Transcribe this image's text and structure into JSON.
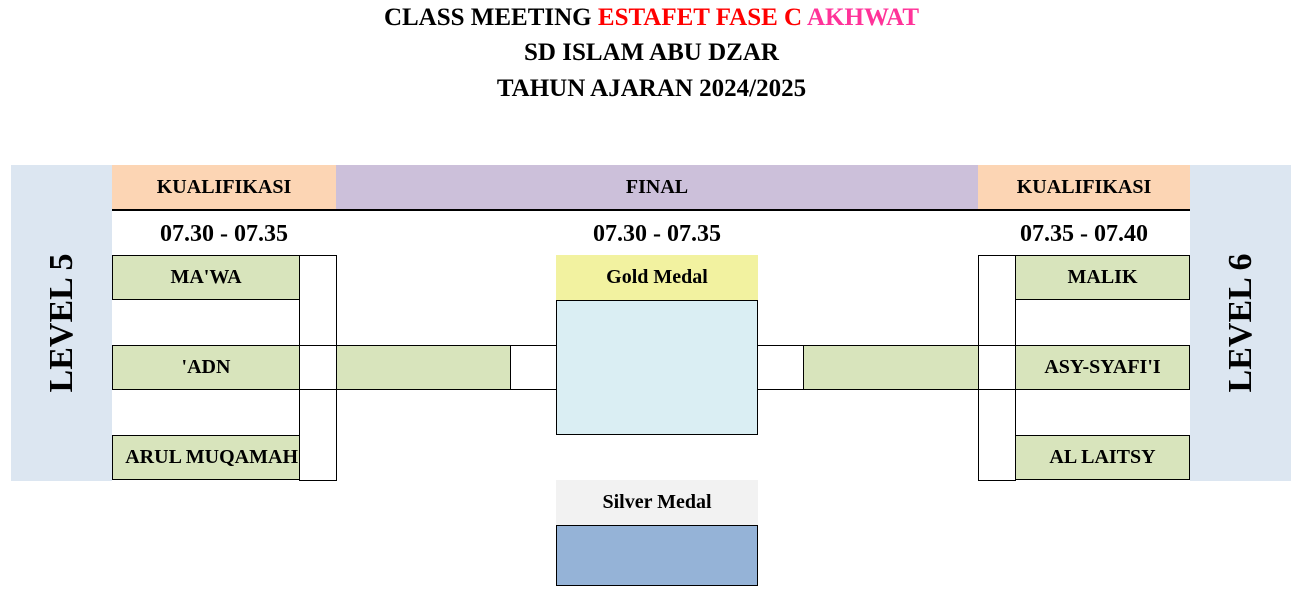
{
  "title": {
    "line1_black": "CLASS MEETING",
    "line1_red": "ESTAFET FASE C",
    "line1_pink": "AKHWAT",
    "line2": "SD ISLAM ABU DZAR",
    "line3": "TAHUN AJARAN 2024/2025"
  },
  "left": {
    "level": "LEVEL 5",
    "header": "KUALIFIKASI",
    "time": "07.30 - 07.35",
    "teams": [
      "MA'WA",
      "'ADN",
      "ARUL MUQAMAH"
    ]
  },
  "center": {
    "header": "FINAL",
    "time": "07.30 - 07.35",
    "gold": "Gold Medal",
    "silver": "Silver Medal"
  },
  "right": {
    "level": "LEVEL 6",
    "header": "KUALIFIKASI",
    "time": "07.35 - 07.40",
    "teams": [
      "MALIK",
      "ASY-SYAFI'I",
      "AL LAITSY"
    ]
  },
  "colors": {
    "level_band": "#dce6f1",
    "qualifier_header": "#fcd5b4",
    "final_header": "#ccc0da",
    "team_cell": "#d8e4bc",
    "gold_header": "#f2f2a0",
    "gold_box": "#daeef3",
    "silver_header": "#f2f2f2",
    "silver_box": "#95b3d7",
    "accent_red": "#ff0000",
    "accent_pink": "#ff3399"
  }
}
